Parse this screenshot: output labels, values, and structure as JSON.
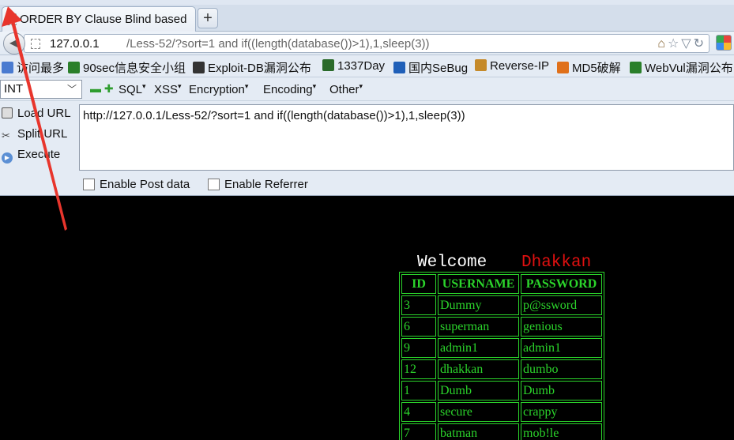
{
  "tab": {
    "title": "ORDER BY Clause Blind based",
    "new_tab": "+"
  },
  "nav": {
    "url_host": "127.0.0.1",
    "url_path": "/Less-52/?sort=1 and if((length(database())>1),1,sleep(3))"
  },
  "bookmarks": [
    {
      "label": "访问最多",
      "icon": "bookmark-icon",
      "color": "#4a7bd0"
    },
    {
      "label": "90sec信息安全小组",
      "icon": "bug-icon",
      "color": "#2a7f2a"
    },
    {
      "label": "Exploit-DB漏洞公布",
      "icon": "exploit-icon",
      "color": "#333333"
    },
    {
      "label": "1337Day",
      "icon": "grid-icon",
      "color": "#2a6a2a"
    },
    {
      "label": "国内SeBug",
      "icon": "s-icon",
      "color": "#1f5fb8"
    },
    {
      "label": "Reverse-IP",
      "icon": "pencil-icon",
      "color": "#c58a2a"
    },
    {
      "label": "MD5破解",
      "icon": "c-icon",
      "color": "#e0701a"
    },
    {
      "label": "WebVul漏洞公布",
      "icon": "bug-icon",
      "color": "#2a7f2a"
    }
  ],
  "hackbar": {
    "select_value": "INT",
    "menus": [
      "SQL",
      "XSS",
      "Encryption",
      "Encoding",
      "Other"
    ],
    "load_url": "Load URL",
    "split_url": "Split URL",
    "execute": "Execute",
    "url_text": "http://127.0.0.1/Less-52/?sort=1 and if((length(database())>1),1,sleep(3))",
    "enable_post": "Enable Post data",
    "enable_referrer": "Enable Referrer"
  },
  "page": {
    "welcome": "Welcome",
    "user_name": "Dhakkan",
    "table_headers": [
      "ID",
      "USERNAME",
      "PASSWORD"
    ],
    "rows": [
      [
        "3",
        "Dummy",
        "p@ssword"
      ],
      [
        "6",
        "superman",
        "genious"
      ],
      [
        "9",
        "admin1",
        "admin1"
      ],
      [
        "12",
        "dhakkan",
        "dumbo"
      ],
      [
        "1",
        "Dumb",
        "Dumb"
      ],
      [
        "4",
        "secure",
        "crappy"
      ],
      [
        "7",
        "batman",
        "mob!le"
      ]
    ]
  },
  "colors": {
    "table_green": "#2bd42b",
    "name_red": "#e01010",
    "arrow_red": "#e8352c"
  }
}
